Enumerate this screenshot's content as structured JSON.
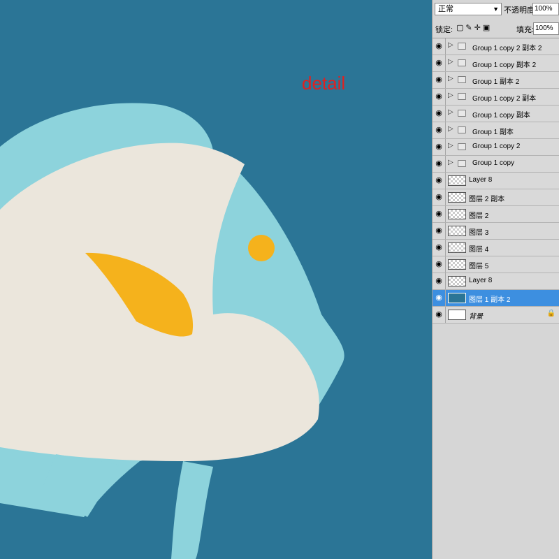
{
  "canvas": {
    "label": "detail",
    "colors": {
      "background": "#2b7596",
      "fish_light_blue": "#8dd3dc",
      "fish_cream": "#ebe6dc",
      "fin_yellow": "#f5b21c",
      "label_red": "#e02020"
    }
  },
  "layers_panel": {
    "blend_mode": "正常",
    "opacity_label": "不透明度:",
    "opacity_value": "100%",
    "lock_label": "锁定:",
    "fill_label": "填充:",
    "fill_value": "100%",
    "layers": [
      {
        "name": "Group 1 copy 2 副本 2",
        "type": "group"
      },
      {
        "name": "Group 1 copy 副本 2",
        "type": "group"
      },
      {
        "name": "Group 1 副本 2",
        "type": "group"
      },
      {
        "name": "Group 1 copy 2 副本",
        "type": "group"
      },
      {
        "name": "Group 1 copy 副本",
        "type": "group"
      },
      {
        "name": "Group 1 副本",
        "type": "group"
      },
      {
        "name": "Group 1 copy 2",
        "type": "group"
      },
      {
        "name": "Group 1 copy",
        "type": "group"
      },
      {
        "name": "Layer 8",
        "type": "layer"
      },
      {
        "name": "图层 2 副本",
        "type": "layer"
      },
      {
        "name": "图层 2",
        "type": "layer"
      },
      {
        "name": "图层 3",
        "type": "layer"
      },
      {
        "name": "图层 4",
        "type": "layer"
      },
      {
        "name": "图层 5",
        "type": "layer"
      },
      {
        "name": "Layer 8",
        "type": "layer"
      },
      {
        "name": "图层 1 副本 2",
        "type": "layer",
        "selected": true
      },
      {
        "name": "背景",
        "type": "background",
        "locked": true
      }
    ]
  }
}
